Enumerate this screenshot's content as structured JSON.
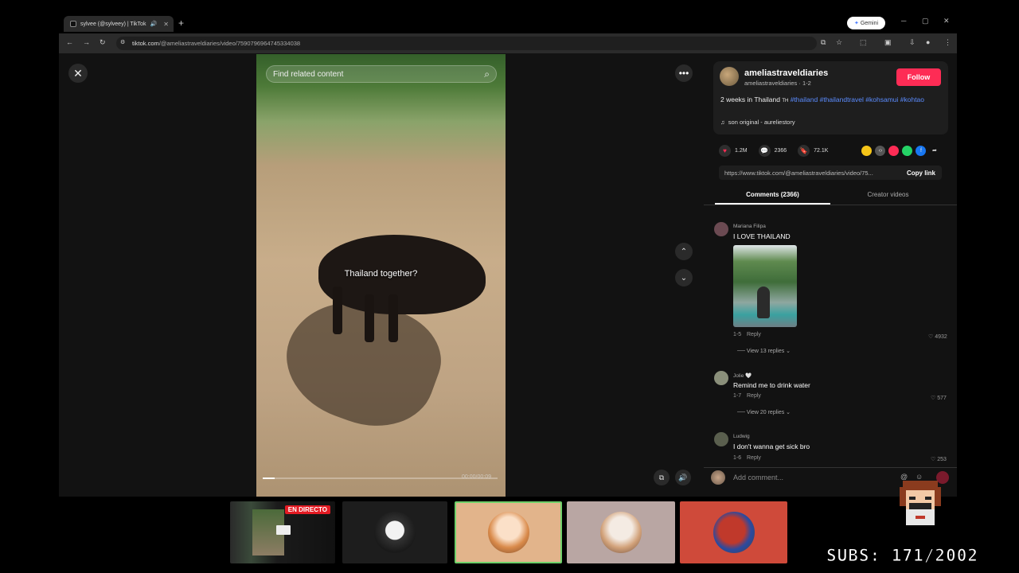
{
  "browser": {
    "tab_title": "sylvee (@sylveey) | TikTok",
    "new_tab": "+",
    "gemini_label": "Gemini",
    "url_domain": "tiktok.com",
    "url_path": "/@ameliastraveldiaries/video/7590796964745334038"
  },
  "video": {
    "search_placeholder": "Find related content",
    "caption": "Thailand together?",
    "timecode": "00:00/00:09",
    "progress": 0.05
  },
  "author": {
    "username": "ameliastraveldiaries",
    "subline": "ameliastraveldiaries · 1-2",
    "follow_label": "Follow",
    "desc_text": "2 weeks in Thailand ",
    "desc_flag": "TH",
    "hashtags": [
      "#thailand",
      "#thailandtravel",
      "#kohsamui",
      "#kohtao"
    ],
    "music": "son original - aureliestory"
  },
  "stats": {
    "likes": "1.2M",
    "comments": "2366",
    "saves": "72.1K"
  },
  "share": {
    "link": "https://www.tiktok.com/@ameliastraveldiaries/video/75...",
    "copy_label": "Copy link",
    "icon_colors": [
      "#f5c518",
      "#555555",
      "#fe2c55",
      "#25d366",
      "#1877f2"
    ]
  },
  "tabs": {
    "comments": "Comments (2366)",
    "creator": "Creator videos"
  },
  "comments": [
    {
      "name": "Mariana Filipa",
      "text": "I LOVE THAILAND",
      "date": "1-5",
      "reply": "Reply",
      "likes": "4932",
      "replies": "View 13 replies"
    },
    {
      "name": "Jolie 🤍",
      "text": "Remind me to drink water",
      "date": "1-7",
      "reply": "Reply",
      "likes": "577",
      "replies": "View 20 replies"
    },
    {
      "name": "Ludwig",
      "text": "I don't wanna get sick bro",
      "date": "1-6",
      "reply": "Reply",
      "likes": "253"
    }
  ],
  "comment_input": {
    "placeholder": "Add comment..."
  },
  "stream": {
    "live_badge": "EN DIRECTO",
    "subs": "SUBS: 171/2002"
  }
}
